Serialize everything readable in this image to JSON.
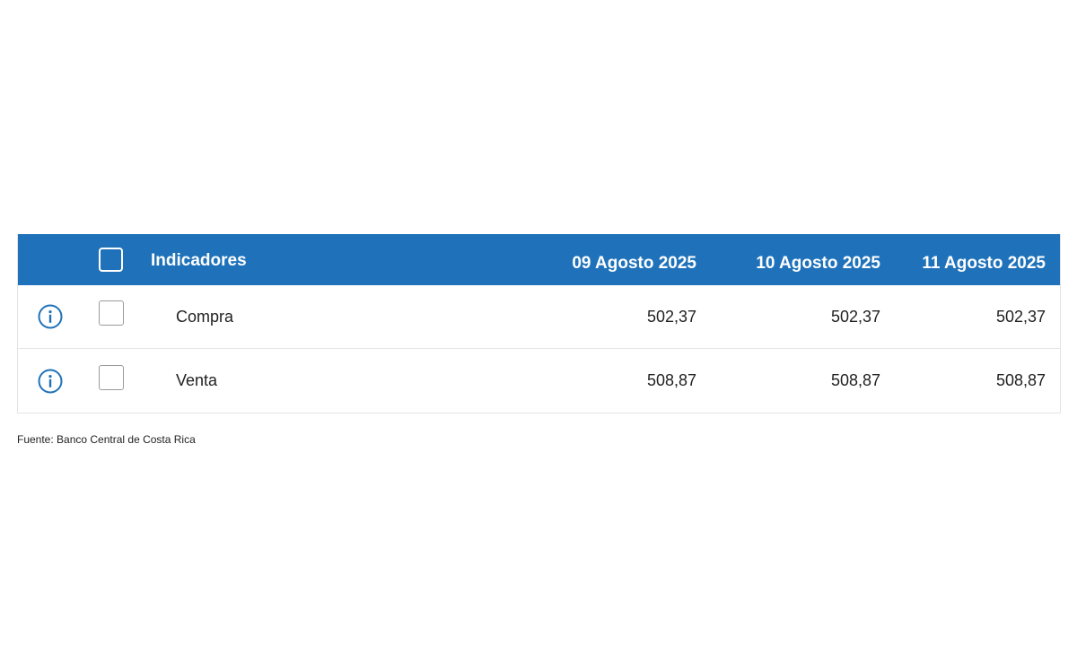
{
  "table": {
    "header": {
      "indicator_label": "Indicadores",
      "dates": [
        "09 Agosto 2025",
        "10 Agosto 2025",
        "11 Agosto 2025"
      ]
    },
    "rows": [
      {
        "name": "Compra",
        "values": [
          "502,37",
          "502,37",
          "502,37"
        ],
        "checked": false
      },
      {
        "name": "Venta",
        "values": [
          "508,87",
          "508,87",
          "508,87"
        ],
        "checked": false
      }
    ]
  },
  "source_note": "Fuente: Banco Central de Costa Rica",
  "colors": {
    "header_bg": "#1f72ba",
    "info_icon": "#1f72ba"
  }
}
